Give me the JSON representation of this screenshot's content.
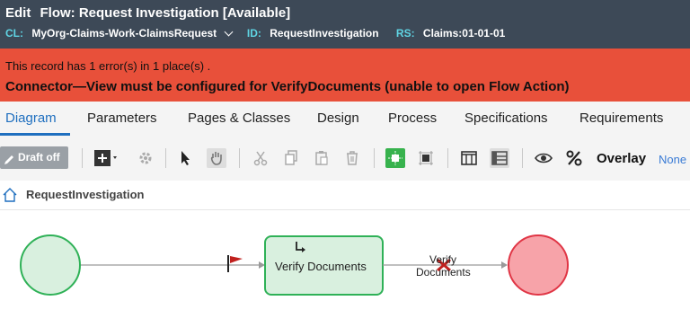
{
  "header": {
    "edit_label": "Edit",
    "title": "Flow: Request Investigation [Available]",
    "cl_key": "CL:",
    "cl_value": "MyOrg-Claims-Work-ClaimsRequest",
    "id_key": "ID:",
    "id_value": "RequestInvestigation",
    "rs_key": "RS:",
    "rs_value": "Claims:01-01-01"
  },
  "error": {
    "summary": "This record has 1 error(s) in 1 place(s) .",
    "detail": "Connector—View must be configured for VerifyDocuments (unable to open Flow Action)"
  },
  "tabs": [
    "Diagram",
    "Parameters",
    "Pages & Classes",
    "Design",
    "Process",
    "Specifications",
    "Requirements"
  ],
  "toolbar": {
    "draft_label": "Draft off",
    "overlay_label": "Overlay",
    "overlay_value": "None"
  },
  "breadcrumb": {
    "label": "RequestInvestigation"
  },
  "flow": {
    "assignment_label": "Verify Documents",
    "connector_label_line1": "Verify",
    "connector_label_line2": "Documents"
  },
  "colors": {
    "header_bg": "#3d4957",
    "error_bg": "#e8503a",
    "accent": "#1f6fbf",
    "start_fill": "#d9f0df",
    "start_stroke": "#2fb157",
    "end_fill": "#f7a3a9",
    "end_stroke": "#e03545"
  }
}
